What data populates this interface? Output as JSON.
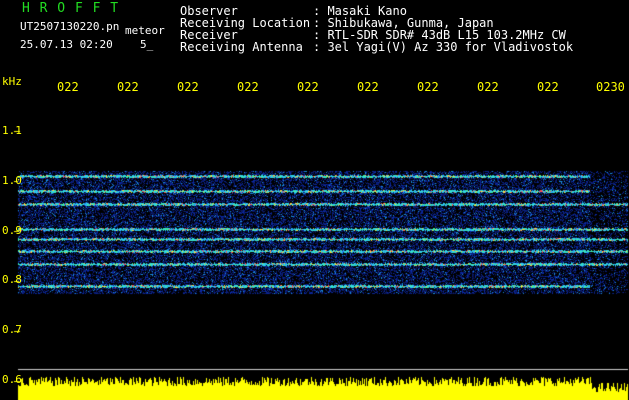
{
  "header": {
    "brand": "H R O F F T",
    "filename": "UT2507130220.pn",
    "mode": "meteor",
    "datetime": "25.07.13 02:20",
    "field_5": "5_",
    "rows": [
      {
        "label": "Observer",
        "value": ": Masaki Kano"
      },
      {
        "label": "Receiving Location",
        "value": ": Shibukawa, Gunma, Japan"
      },
      {
        "label": "Receiver",
        "value": ": RTL-SDR SDR# 43dB L15 103.2MHz CW"
      },
      {
        "label": "Receiving Antenna",
        "value": ": 3el Yagi(V) Az 330 for Vladivostok"
      }
    ]
  },
  "axis": {
    "unit": "kHz",
    "y_ticks": [
      "1.1",
      "1.0",
      "0.9",
      "0.8",
      "0.7",
      "0.6"
    ],
    "time_ticks": [
      "022",
      "022",
      "022",
      "022",
      "022",
      "022",
      "022",
      "022",
      "022",
      "0230"
    ]
  },
  "spectrogram": {
    "signal_lines_khz": [
      1.01,
      0.98,
      0.955,
      0.905,
      0.885,
      0.86,
      0.835,
      0.79
    ],
    "band_top_khz": 1.02,
    "band_bottom_khz": 0.775,
    "colors": {
      "bg": "#000000",
      "noise": "#0b1a8a",
      "line_a": "#2fe0d0",
      "line_b": "#ff4040",
      "strip": "#ffff00"
    }
  }
}
